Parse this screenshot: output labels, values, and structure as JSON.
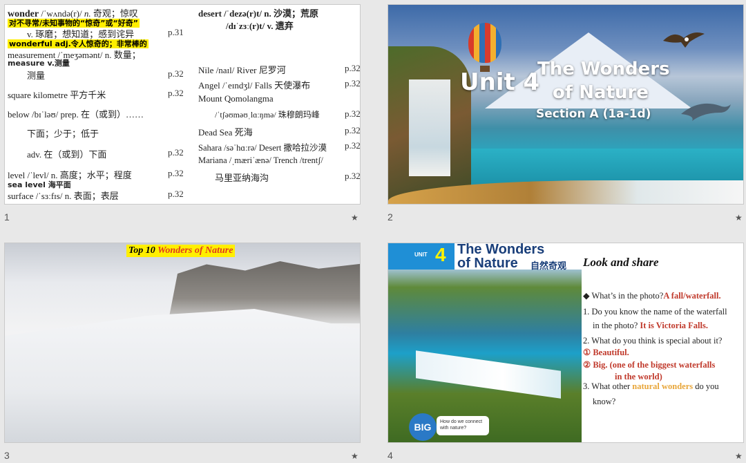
{
  "slides": [
    {
      "number": "1",
      "left_col": {
        "wonder_word": "wonder",
        "wonder_phon": " /ˈwʌndə(r)/ ",
        "wonder_pos": "n.",
        "wonder_def": " 奇观；惊叹",
        "wonder_note": "对不寻常/未知事物的“惊奇”或“好奇”",
        "wonder_v": "v. 琢磨；想知道；感到诧异",
        "wonder_v_page": "p.31",
        "wonderful": "wonderful adj.令人惊奇的；非常棒的",
        "measurement": "measurement /ˈmeʒəmənt/ n. 数量；",
        "measure_v": "measure v.测量",
        "measure_cn": "测量",
        "measure_page": "p.32",
        "square": "square kilometre  平方千米",
        "square_page": "p.32",
        "below": "below /bɪˈləʊ/ prep. 在（或到）……",
        "below_cn": "下面；少于；低于",
        "below_adv": "adv. 在（或到）下面",
        "below_page": "p.32",
        "level": "level /ˈlevl/ n. 高度；水平；程度",
        "level_page": "p.32",
        "sea_level": "sea level 海平面",
        "surface": "surface /ˈsɜːfɪs/ n. 表面；表层",
        "surface_page": "p.32"
      },
      "right_col": {
        "desert": "desert /ˈdezə(r)t/ n. 沙漠；荒原",
        "desert_v": "/dɪˈzɜː(r)t/ v. 遗弃",
        "nile": "Nile /naɪl/ River 尼罗河",
        "nile_page": "p.32",
        "angel": "Angel /ˈeɪndʒl/ Falls 天使瀑布",
        "angel_page": "p.32",
        "mount": "Mount Qomolangma",
        "mount_phon": "/ˈtʃəʊməʊˌlɑːŋmə/ 珠穆朗玛峰",
        "mount_page": "p.32",
        "dead_sea": "Dead Sea 死海",
        "dead_sea_page": "p.32",
        "sahara": "Sahara /səˈhɑːrə/ Desert 撒哈拉沙漠",
        "sahara_page": "p.32",
        "mariana": "Mariana /ˌmæriˈænə/ Trench /trentʃ/",
        "mariana_cn": "马里亚纳海沟",
        "mariana_page": "p.32"
      }
    },
    {
      "number": "2",
      "unit": "Unit 4",
      "title_line1": "The Wonders",
      "title_line2": "of Nature",
      "section": "Section A (1a-1d)"
    },
    {
      "number": "3",
      "caption_prefix": "Top 10 ",
      "caption_highlight": "Wonders of Nature"
    },
    {
      "number": "4",
      "unit_label": "UNIT",
      "unit_number": "4",
      "banner_line1": "The Wonders",
      "banner_line2": "of Nature",
      "banner_cn": "自然奇观",
      "big_label": "BIG",
      "big_question": "How do we connect with nature?",
      "look_share": "Look and share",
      "q0": "◆  What’s in the photo?",
      "q0_ans": "A fall/waterfall.",
      "q1a": "1. Do you know the name of the waterfall",
      "q1b": "in the photo? ",
      "q1_ans": "It is Victoria Falls.",
      "q2": "2. What do you think is special about it?",
      "q2_a1": "① Beautiful.",
      "q2_a2a": "② Big. (one of the biggest waterfalls",
      "q2_a2b": "in the world)",
      "q3a": "3. What other ",
      "q3_nat": "natural wonders",
      "q3b": " do you",
      "q3c": "know?"
    }
  ],
  "star_symbol": "★"
}
